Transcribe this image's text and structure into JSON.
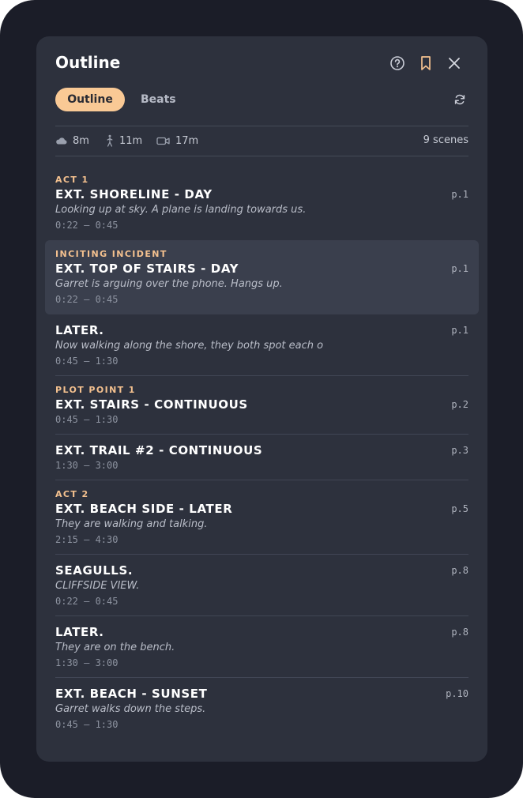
{
  "panel": {
    "title": "Outline"
  },
  "tabs": [
    {
      "label": "Outline",
      "active": true
    },
    {
      "label": "Beats",
      "active": false
    }
  ],
  "stats": {
    "weather": "8m",
    "walk": "11m",
    "camera": "17m",
    "scene_count": "9 scenes"
  },
  "scenes": [
    {
      "beat": "ACT 1",
      "heading": "EXT. SHORELINE - DAY",
      "synopsis": "Looking up at sky. A plane is landing towards us.",
      "time": "0:22 – 0:45",
      "page": "p.1"
    },
    {
      "beat": "INCITING INCIDENT",
      "heading": "EXT. TOP OF STAIRS - DAY",
      "synopsis": "Garret is arguing over the phone. Hangs up.",
      "time": "0:22 – 0:45",
      "page": "p.1",
      "selected": true
    },
    {
      "beat": "",
      "heading": "LATER.",
      "synopsis": "Now walking along the shore, they both spot each o",
      "time": "0:45 – 1:30",
      "page": "p.1"
    },
    {
      "beat": "PLOT POINT 1",
      "heading": "EXT. STAIRS - CONTINUOUS",
      "synopsis": "",
      "time": "0:45 – 1:30",
      "page": "p.2"
    },
    {
      "beat": "",
      "heading": "EXT. TRAIL #2 - CONTINUOUS",
      "synopsis": "",
      "time": "1:30 – 3:00",
      "page": "p.3"
    },
    {
      "beat": "ACT 2",
      "heading": "EXT. BEACH SIDE - LATER",
      "synopsis": "They are walking and talking.",
      "time": "2:15 – 4:30",
      "page": "p.5"
    },
    {
      "beat": "",
      "heading": "SEAGULLS.",
      "synopsis": "CLIFFSIDE VIEW.",
      "time": "0:22 – 0:45",
      "page": "p.8"
    },
    {
      "beat": "",
      "heading": "LATER.",
      "synopsis": "They are on the bench.",
      "time": "1:30 – 3:00",
      "page": "p.8"
    },
    {
      "beat": "",
      "heading": "EXT. BEACH - SUNSET",
      "synopsis": "Garret walks down the steps.",
      "time": "0:45 – 1:30",
      "page": "p.10"
    }
  ],
  "icons": {
    "help": "help-circle-icon",
    "bookmark": "bookmark-icon",
    "close": "close-icon",
    "refresh": "refresh-icon",
    "weather": "cloud-icon",
    "walk": "walking-icon",
    "camera": "camera-icon"
  },
  "colors": {
    "accent": "#f9c995",
    "bookmark": "#f4c18f",
    "panel": "#2d313d",
    "frame": "#1b1d28",
    "selected_row": "#3a3f4d"
  }
}
